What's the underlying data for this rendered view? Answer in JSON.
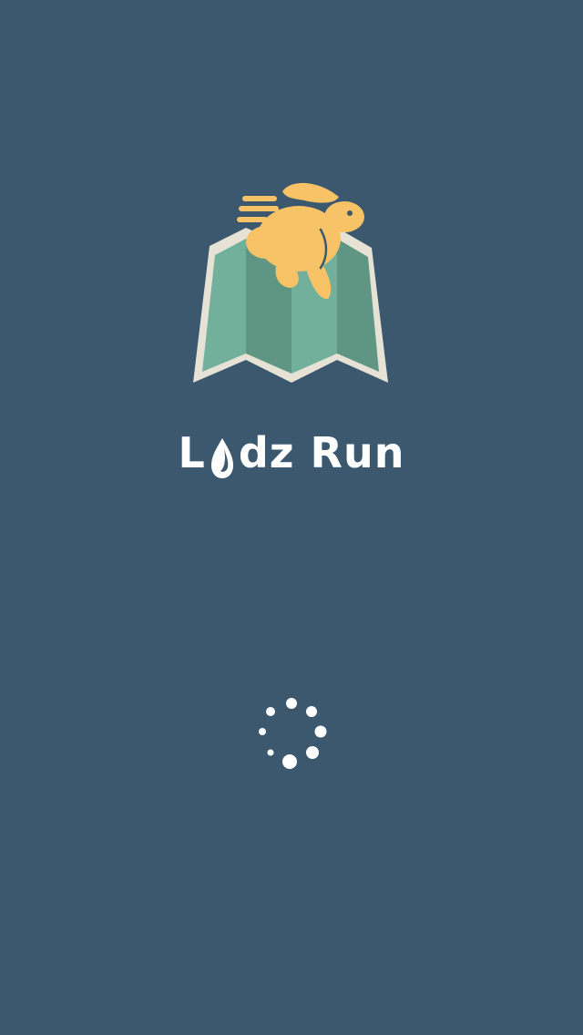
{
  "app": {
    "title_prefix": "L",
    "title_suffix": "dz Run",
    "logo_icon": "rabbit-on-map-icon",
    "loading_icon": "loading-spinner-icon"
  },
  "colors": {
    "background": "#3b586e",
    "rabbit": "#f8c366",
    "map_light": "#72b09b",
    "map_dark": "#5f9583",
    "map_border": "#e6e3d6",
    "text": "#ffffff"
  }
}
